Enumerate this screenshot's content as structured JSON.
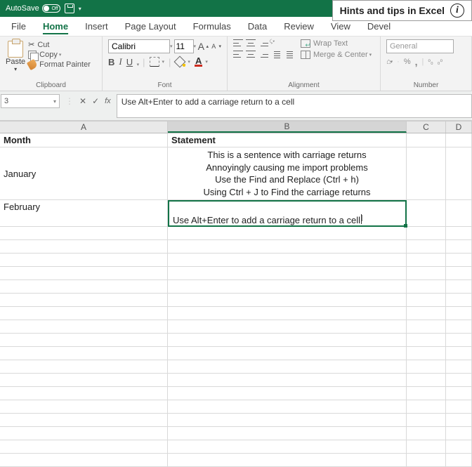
{
  "title_bar": {
    "autosave_label": "AutoSave",
    "autosave_state": "Off"
  },
  "hints_box": {
    "text": "Hints and tips in Excel"
  },
  "tabs": {
    "file": "File",
    "home": "Home",
    "insert": "Insert",
    "pagelayout": "Page Layout",
    "formulas": "Formulas",
    "data": "Data",
    "review": "Review",
    "view": "View",
    "developer": "Devel"
  },
  "ribbon": {
    "clipboard": {
      "paste": "Paste",
      "cut": "Cut",
      "copy": "Copy",
      "painter": "Format Painter",
      "group": "Clipboard"
    },
    "font": {
      "name": "Calibri",
      "size": "11",
      "bold": "B",
      "italic": "I",
      "underline": "U",
      "fontcolor": "A",
      "bigA": "A",
      "smA": "A",
      "group": "Font"
    },
    "alignment": {
      "wrap": "Wrap Text",
      "merge": "Merge & Center",
      "group": "Alignment"
    },
    "number": {
      "format": "General",
      "percent": "%",
      "comma": ",",
      "dec1": ".0",
      "dec2": ".00",
      "group": "Number"
    }
  },
  "namebox": "3",
  "formula": "Use Alt+Enter to add a carriage return to a cell",
  "columns": {
    "A": "A",
    "B": "B",
    "C": "C",
    "D": "D"
  },
  "sheet": {
    "header_month": "Month",
    "header_statement": "Statement",
    "jan": "January",
    "jan_lines": {
      "l1": "This is a sentence with carriage returns",
      "l2": "Annoyingly causing me import problems",
      "l3": "Use the Find and Replace (Ctrl + h)",
      "l4": "Using Ctrl + J to Find the carriage returns"
    },
    "feb": "February",
    "feb_text": "Use Alt+Enter to add a carriage return to a cell"
  }
}
